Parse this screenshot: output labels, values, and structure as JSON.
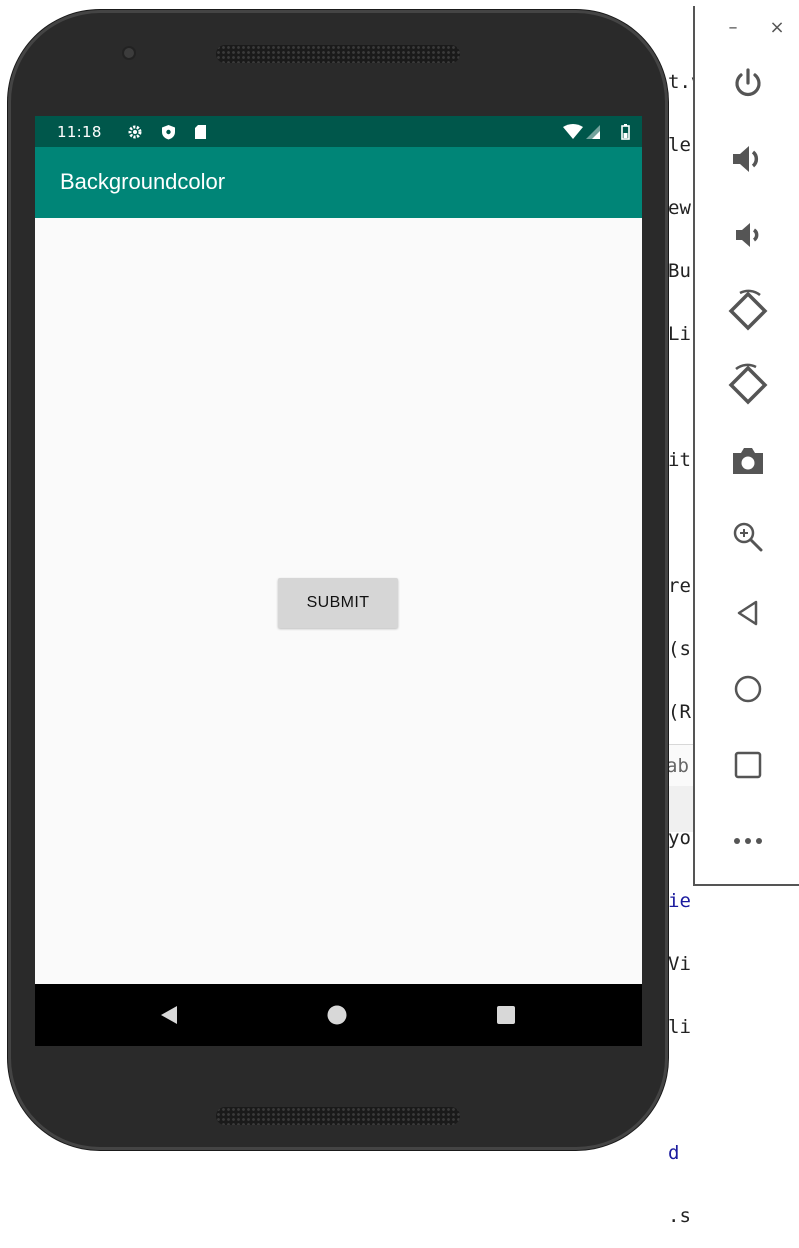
{
  "status_bar": {
    "time": "11:18",
    "icons": [
      "settings-icon",
      "shield-icon",
      "sd-card-icon",
      "wifi-icon",
      "signal-icon",
      "battery-icon"
    ]
  },
  "app_bar": {
    "title": "Backgroundcolor"
  },
  "main": {
    "submit_label": "SUBMIT"
  },
  "nav_bar": {
    "buttons": [
      "back-icon",
      "home-icon",
      "recents-icon"
    ]
  },
  "emulator_panel": {
    "minimize_label": "–",
    "close_label": "×",
    "tools": [
      "power-icon",
      "volume-up-icon",
      "volume-down-icon",
      "rotate-left-icon",
      "rotate-right-icon",
      "camera-icon",
      "zoom-icon",
      "back-icon",
      "home-icon",
      "overview-icon",
      "more-icon"
    ]
  },
  "ide_background": {
    "code_fragments": [
      "t.v",
      "le",
      "ew",
      "Bu",
      "Li",
      "",
      "it",
      "",
      "re",
      "(s",
      "(R",
      ";",
      "yo",
      "ie",
      "Vi",
      "li",
      "",
      "d",
      ".s"
    ],
    "bottom_fragment": "ab"
  },
  "colors": {
    "status_bar": "#00574b",
    "app_bar": "#008577",
    "screen_background": "#fafafa",
    "button": "#d6d6d6"
  }
}
